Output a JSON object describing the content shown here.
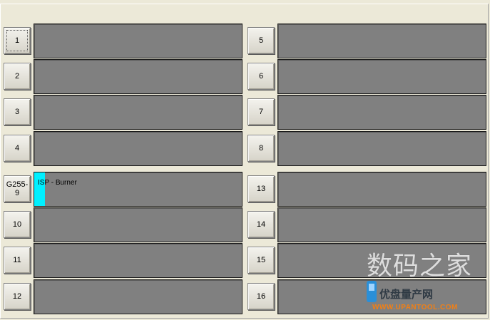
{
  "left_column": [
    {
      "label": "1",
      "status": "",
      "progress": 0,
      "focused": true
    },
    {
      "label": "2",
      "status": "",
      "progress": 0
    },
    {
      "label": "3",
      "status": "",
      "progress": 0
    },
    {
      "label": "4",
      "status": "",
      "progress": 0
    },
    {
      "label": "G255-9",
      "status": "ISP - Burner",
      "progress": 0.05
    },
    {
      "label": "10",
      "status": "",
      "progress": 0
    },
    {
      "label": "11",
      "status": "",
      "progress": 0
    },
    {
      "label": "12",
      "status": "",
      "progress": 0
    }
  ],
  "right_column": [
    {
      "label": "5",
      "status": "",
      "progress": 0
    },
    {
      "label": "6",
      "status": "",
      "progress": 0
    },
    {
      "label": "7",
      "status": "",
      "progress": 0
    },
    {
      "label": "8",
      "status": "",
      "progress": 0
    },
    {
      "label": "13",
      "status": "",
      "progress": 0
    },
    {
      "label": "14",
      "status": "",
      "progress": 0
    },
    {
      "label": "15",
      "status": "",
      "progress": 0
    },
    {
      "label": "16",
      "status": "",
      "progress": 0
    }
  ],
  "colors": {
    "panel_bg": "#808080",
    "progress": "#00f0ff",
    "window_bg": "#ece9d8"
  },
  "watermark": {
    "line1": "数码之家",
    "logo_text": "优盘量产网",
    "url": "WWW.UPANTOOL.COM"
  }
}
